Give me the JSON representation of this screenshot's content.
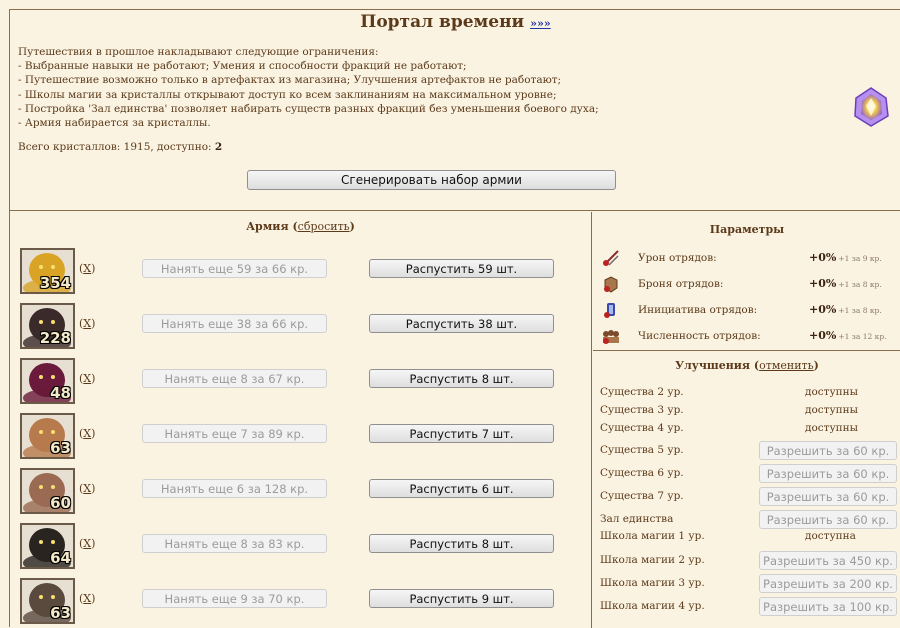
{
  "header": {
    "title": "Портал времени",
    "more_link": "»»»"
  },
  "restrictions": [
    "Путешествия в прошлое накладывают следующие ограничения:",
    "- Выбранные навыки не работают; Умения и способности фракций не работают;",
    "- Путешествие возможно только в артефактах из магазина; Улучшения артефактов не работают;",
    "- Школы магии за кристаллы открывают доступ ко всем заклинаниям на максимальном уровне;",
    "- Постройка 'Зал единства' позволяет набирать существ разных фракций без уменьшения боевого духа;",
    "- Армия набирается за кристаллы."
  ],
  "crystals": {
    "prefix": "Всего кристаллов: 1915, доступно: ",
    "available": "2"
  },
  "generate_button": "Сгенерировать набор армии",
  "army": {
    "title": "Армия",
    "reset_open": "(",
    "reset_link": "сбросить",
    "reset_close": ")",
    "units": [
      {
        "count": "354",
        "remove": "X",
        "hire": "Нанять еще 59 за 66 кр.",
        "dismiss": "Распустить 59 шт.",
        "icon": "griffin-portrait-icon",
        "color": "#d9a426"
      },
      {
        "count": "228",
        "remove": "X",
        "hire": "Нанять еще 38 за 66 кр.",
        "dismiss": "Распустить 38 шт.",
        "icon": "dragon-portrait-icon",
        "color": "#3a2a2a"
      },
      {
        "count": "48",
        "remove": "X",
        "hire": "Нанять еще 8 за 67 кр.",
        "dismiss": "Распустить 8 шт.",
        "icon": "demon-portrait-icon",
        "color": "#6a1a3a"
      },
      {
        "count": "63",
        "remove": "X",
        "hire": "Нанять еще 7 за 89 кр.",
        "dismiss": "Распустить 7 шт.",
        "icon": "mummy-portrait-icon",
        "color": "#b77a4c"
      },
      {
        "count": "60",
        "remove": "X",
        "hire": "Нанять еще 6 за 128 кр.",
        "dismiss": "Распустить 6 шт.",
        "icon": "pharaoh-portrait-icon",
        "color": "#9a6a52"
      },
      {
        "count": "64",
        "remove": "X",
        "hire": "Нанять еще 8 за 83 кр.",
        "dismiss": "Распустить 8 шт.",
        "icon": "anubis-portrait-icon",
        "color": "#2a2420"
      },
      {
        "count": "63",
        "remove": "X",
        "hire": "Нанять еще 9 за 70 кр.",
        "dismiss": "Распустить 9 шт.",
        "icon": "jackal-portrait-icon",
        "color": "#5a4a3e"
      }
    ]
  },
  "parameters": {
    "title": "Параметры",
    "items": [
      {
        "label": "Урон отрядов:",
        "value": "+0%",
        "note": "+1 за 9 кр.",
        "icon": "damage-icon"
      },
      {
        "label": "Броня отрядов:",
        "value": "+0%",
        "note": "+1 за 8 кр.",
        "icon": "armor-icon"
      },
      {
        "label": "Инициатива отрядов:",
        "value": "+0%",
        "note": "+1 за 8 кр.",
        "icon": "initiative-icon"
      },
      {
        "label": "Численность отрядов:",
        "value": "+0%",
        "note": "+1 за 12 кр.",
        "icon": "troop-count-icon"
      }
    ]
  },
  "upgrades": {
    "title": "Улучшения",
    "cancel_open": "(",
    "cancel_link": "отменить",
    "cancel_close": ")",
    "items": [
      {
        "label": "Существа 2 ур.",
        "status": "доступны",
        "button": ""
      },
      {
        "label": "Существа 3 ур.",
        "status": "доступны",
        "button": ""
      },
      {
        "label": "Существа 4 ур.",
        "status": "доступны",
        "button": ""
      },
      {
        "label": "Существа 5 ур.",
        "status": "",
        "button": "Разрешить за 60 кр."
      },
      {
        "label": "Существа 6 ур.",
        "status": "",
        "button": "Разрешить за 60 кр."
      },
      {
        "label": "Существа 7 ур.",
        "status": "",
        "button": "Разрешить за 60 кр."
      },
      {
        "label": "Зал единства",
        "status": "",
        "button": "Разрешить за 60 кр."
      },
      {
        "label": "Школа магии 1 ур.",
        "status": "доступна",
        "button": ""
      },
      {
        "label": "Школа магии 2 ур.",
        "status": "",
        "button": "Разрешить за 450 кр."
      },
      {
        "label": "Школа магии 3 ур.",
        "status": "",
        "button": "Разрешить за 200 кр."
      },
      {
        "label": "Школа магии 4 ур.",
        "status": "",
        "button": "Разрешить за 100 кр."
      }
    ]
  }
}
